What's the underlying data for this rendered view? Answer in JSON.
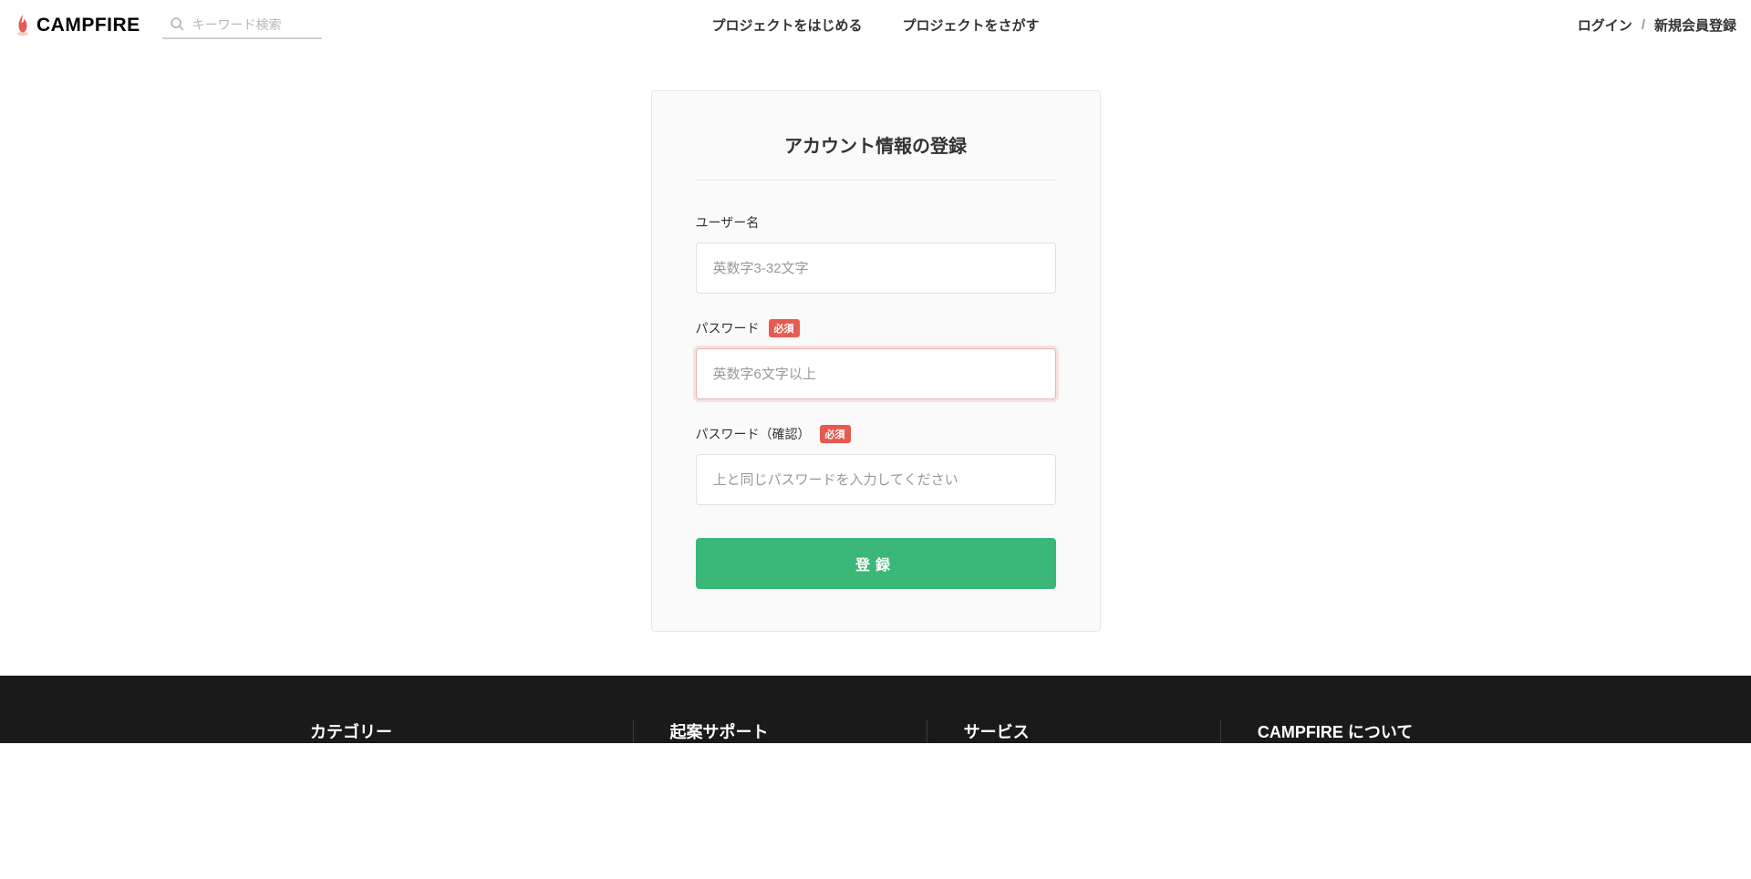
{
  "header": {
    "logo_text": "CAMPFIRE",
    "search_placeholder": "キーワード検索",
    "nav_center": {
      "start_project": "プロジェクトをはじめる",
      "find_project": "プロジェクトをさがす"
    },
    "nav_right": {
      "login": "ログイン",
      "divider": "/",
      "signup": "新規会員登録"
    }
  },
  "form": {
    "title": "アカウント情報の登録",
    "username": {
      "label": "ユーザー名",
      "placeholder": "英数字3-32文字"
    },
    "password": {
      "label": "パスワード",
      "required_badge": "必須",
      "placeholder": "英数字6文字以上"
    },
    "password_confirm": {
      "label": "パスワード（確認）",
      "required_badge": "必須",
      "placeholder": "上と同じパスワードを入力してください"
    },
    "submit_label": "登録"
  },
  "footer": {
    "columns": {
      "category": "カテゴリー",
      "support": "起案サポート",
      "service": "サービス",
      "about": "CAMPFIRE について"
    }
  }
}
